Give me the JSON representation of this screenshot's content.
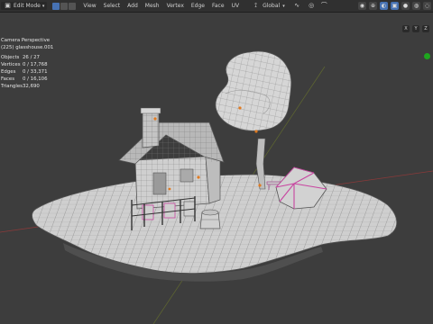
{
  "header": {
    "mode": "Edit Mode",
    "menus": [
      "View",
      "Select",
      "Add",
      "Mesh",
      "Vertex",
      "Edge",
      "Face",
      "UV"
    ],
    "pivot": "Global",
    "axes": [
      "X",
      "Y",
      "Z"
    ]
  },
  "overlay": {
    "view_name": "Camera Perspective",
    "object": "(225) glasshouse.001",
    "stats": [
      {
        "label": "Objects",
        "value": "26 / 27"
      },
      {
        "label": "Vertices",
        "value": "0 / 17,768"
      },
      {
        "label": "Edges",
        "value": "0 / 33,371"
      },
      {
        "label": "Faces",
        "value": "0 / 16,106"
      },
      {
        "label": "Triangles",
        "value": "32,690"
      }
    ]
  },
  "colors": {
    "header_bg": "#303030",
    "viewport_bg": "#3d3d3d",
    "mesh": "#d0d0d0",
    "wire": "#6a6a6a",
    "selected_edge": "#c844a0",
    "axis_x": "#a03a3a",
    "axis_y": "#6e8a28",
    "active_blue": "#4772b3",
    "status_green": "#1ea61e"
  }
}
